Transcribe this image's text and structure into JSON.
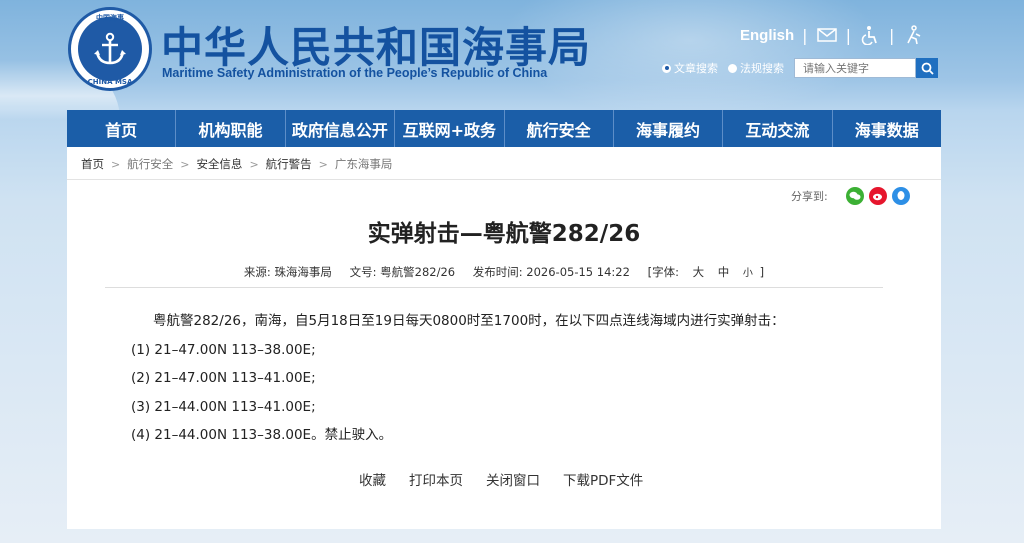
{
  "header": {
    "title_cn": "中华人民共和国海事局",
    "title_en": "Maritime Safety Administration of the People’s Republic of China",
    "logo_top_text": "中国海事",
    "logo_bottom_text": "CHINA MSA",
    "lang_link": "English",
    "icons": [
      "mail-icon",
      "accessibility-icon",
      "elder-mode-icon"
    ],
    "search": {
      "radio_article": "文章搜索",
      "radio_law": "法规搜索",
      "placeholder": "请输入关键字"
    }
  },
  "nav": {
    "items": [
      "首页",
      "机构职能",
      "政府信息公开",
      "互联网+政务",
      "航行安全",
      "海事履约",
      "互动交流",
      "海事数据"
    ]
  },
  "breadcrumb": [
    "首页",
    "航行安全",
    "安全信息",
    "航行警告",
    "广东海事局"
  ],
  "share": {
    "label": "分享到:"
  },
  "article": {
    "title": "实弹射击—粤航警282/26",
    "meta": {
      "source_label": "来源:",
      "source": "珠海海事局",
      "doc_no_label": "文号:",
      "doc_no": "粤航警282/26",
      "time_label": "发布时间:",
      "time": "2026-05-15 14:22",
      "font_label": "[字体:",
      "font_large": "大",
      "font_medium": "中",
      "font_small": "小",
      "font_end": "]"
    },
    "paragraphs": [
      "粤航警282/26，南海，自5月18日至19日每天0800时至1700时，在以下四点连线海域内进行实弹射击：",
      "(1) 21–47.00N 113–38.00E;",
      "(2) 21–47.00N 113–41.00E;",
      "(3) 21–44.00N 113–41.00E;",
      "(4) 21–44.00N 113–38.00E。禁止驶入。"
    ],
    "actions": [
      "收藏",
      "打印本页",
      "关闭窗口",
      "下载PDF文件"
    ]
  },
  "colors": {
    "brand_blue": "#1b5ea8",
    "title_blue": "#1452a0",
    "wechat_green": "#3cb034",
    "weibo_red": "#e6162d",
    "qq_blue": "#2d8fe6"
  }
}
